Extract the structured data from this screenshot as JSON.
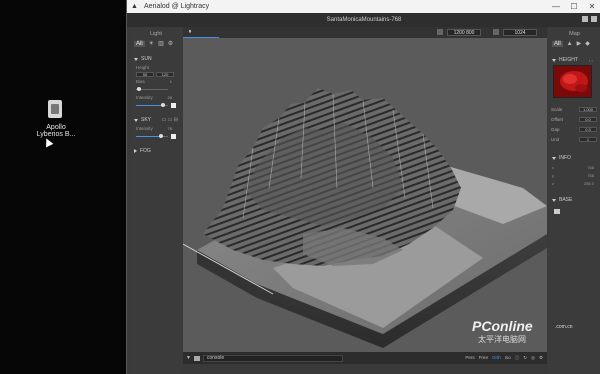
{
  "desktop": {
    "icon_label_line1": "Apollo",
    "icon_label_line2": "Lyberios B..."
  },
  "window": {
    "title": "Aerialod @ Lightracy",
    "logo_glyph": "▲",
    "controls": {
      "minimize": "—",
      "maximize": "☐",
      "close": "✕"
    }
  },
  "doc": {
    "name": "SantaMonicaMountains-768"
  },
  "left_panel": {
    "tab": "Light",
    "icons": {
      "all": "All",
      "sun": "☀",
      "bars": "▥",
      "gear": "⚙"
    },
    "sun_section": {
      "title": "SUN",
      "height_label": "Height",
      "height_values": [
        "50",
        "120"
      ],
      "bias_label": "Bias",
      "bias_value": "1",
      "intensity_label": "Intensity",
      "intensity_value": "25"
    },
    "sky_section": {
      "title": "SKY",
      "intensity_label": "Intensity",
      "intensity_value": "75"
    },
    "fog_section": {
      "title": "FOG"
    }
  },
  "viewport": {
    "pause_glyph": "⏸",
    "resolution": "1200 800",
    "samples": "1024",
    "console_label": "console",
    "modes": [
      "Pers",
      "Free",
      "Orth",
      "Iso"
    ],
    "active_mode": "Orth"
  },
  "right_panel": {
    "tab": "Map",
    "icons": {
      "all": "All"
    },
    "height_section": {
      "title": "HEIGHT",
      "scale_label": "Scale",
      "scale_value": "1.000",
      "offset_label": "Offset",
      "offset_value": "0.0",
      "gap_label": "Gap",
      "gap_value": "0.3",
      "unit_label": "Unit",
      "unit_value": "1"
    },
    "info_section": {
      "title": "INFO",
      "rows": [
        {
          "k": "x",
          "v": "768"
        },
        {
          "k": "y",
          "v": "768"
        },
        {
          "k": "z",
          "v": "255.0"
        }
      ]
    },
    "base_section": {
      "title": "BASE"
    }
  },
  "watermark": {
    "brand": "PConline",
    "url": ".com.cn",
    "cn_text": "太平洋电脑网"
  },
  "colors": {
    "accent": "#4a90e2",
    "heightmap": "#c01818"
  }
}
